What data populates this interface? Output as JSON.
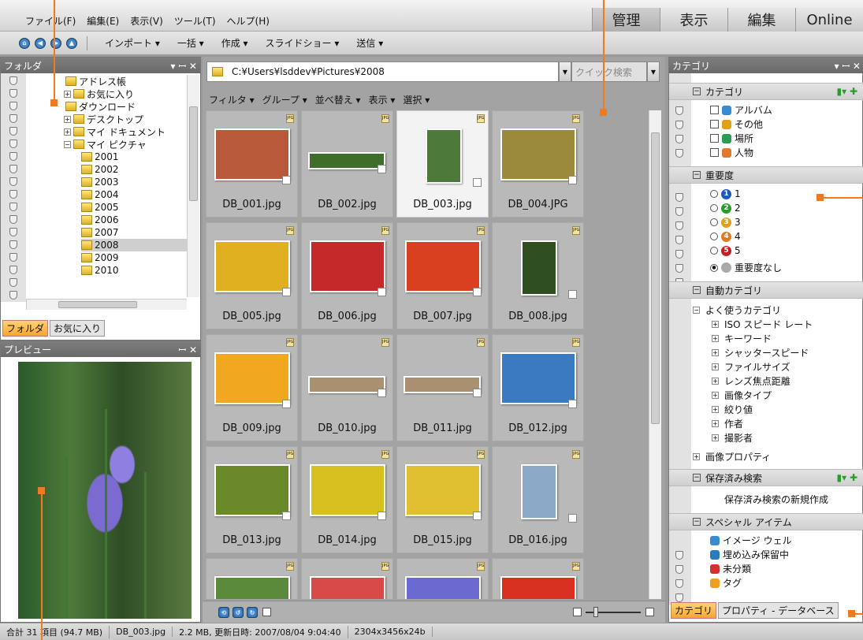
{
  "menu": [
    "ファイル(F)",
    "編集(E)",
    "表示(V)",
    "ツール(T)",
    "ヘルプ(H)"
  ],
  "modes": [
    "管理",
    "表示",
    "編集",
    "Online"
  ],
  "toolbar": {
    "items": [
      "インポート ▾",
      "一括 ▾",
      "作成 ▾",
      "スライドショー ▾",
      "送信 ▾"
    ]
  },
  "folder_pane": {
    "title": "フォルダ",
    "tree": [
      {
        "label": "アドレス帳",
        "level": 2
      },
      {
        "label": "お気に入り",
        "level": 1
      },
      {
        "label": "ダウンロード",
        "level": 2
      },
      {
        "label": "デスクトップ",
        "level": 1
      },
      {
        "label": "マイ ドキュメント",
        "level": 1
      },
      {
        "label": "マイ ピクチャ",
        "level": 1
      },
      {
        "label": "2001",
        "level": 3
      },
      {
        "label": "2002",
        "level": 3
      },
      {
        "label": "2003",
        "level": 3
      },
      {
        "label": "2004",
        "level": 3
      },
      {
        "label": "2005",
        "level": 3
      },
      {
        "label": "2006",
        "level": 3
      },
      {
        "label": "2007",
        "level": 3
      },
      {
        "label": "2008",
        "level": 3
      },
      {
        "label": "2009",
        "level": 3
      },
      {
        "label": "2010",
        "level": 3
      }
    ],
    "tabs": [
      "フォルダ",
      "お気に入り"
    ]
  },
  "preview_pane": {
    "title": "プレビュー"
  },
  "path": "C:¥Users¥lsddev¥Pictures¥2008",
  "quick_search_placeholder": "クイック検索",
  "filters": [
    "フィルタ ▾",
    "グループ ▾",
    "並べ替え ▾",
    "表示 ▾",
    "選択 ▾"
  ],
  "thumbnails": [
    {
      "name": "DB_001.jpg",
      "color": "#b85a3a"
    },
    {
      "name": "DB_002.jpg",
      "color": "#3f6d2a"
    },
    {
      "name": "DB_003.jpg",
      "color": "#4d7a3a",
      "selected": true
    },
    {
      "name": "DB_004.JPG",
      "color": "#9a8a3a"
    },
    {
      "name": "DB_005.jpg",
      "color": "#e0b020"
    },
    {
      "name": "DB_006.jpg",
      "color": "#c42a2a"
    },
    {
      "name": "DB_007.jpg",
      "color": "#d84020"
    },
    {
      "name": "DB_008.jpg",
      "color": "#2f4f20"
    },
    {
      "name": "DB_009.jpg",
      "color": "#f0a820"
    },
    {
      "name": "DB_010.jpg",
      "color": "#a89070"
    },
    {
      "name": "DB_011.jpg",
      "color": "#a89070"
    },
    {
      "name": "DB_012.jpg",
      "color": "#3a7ac0"
    },
    {
      "name": "DB_013.jpg",
      "color": "#6a8a2a"
    },
    {
      "name": "DB_014.jpg",
      "color": "#d8c020"
    },
    {
      "name": "DB_015.jpg",
      "color": "#e0c030"
    },
    {
      "name": "DB_016.jpg",
      "color": "#8aaac8"
    },
    {
      "name": "",
      "color": "#5a8a3a"
    },
    {
      "name": "",
      "color": "#d84a4a"
    },
    {
      "name": "",
      "color": "#6a6ad0"
    },
    {
      "name": "",
      "color": "#d83020"
    }
  ],
  "category_pane": {
    "title": "カテゴリ",
    "sections": {
      "categories": "カテゴリ",
      "category_items": [
        "アルバム",
        "その他",
        "場所",
        "人物"
      ],
      "importance": "重要度",
      "importance_items": [
        "1",
        "2",
        "3",
        "4",
        "5"
      ],
      "importance_none": "重要度なし",
      "auto": "自動カテゴリ",
      "auto_root": "よく使うカテゴリ",
      "auto_items": [
        "ISO スピード レート",
        "キーワード",
        "シャッタースピード",
        "ファイルサイズ",
        "レンズ焦点距離",
        "画像タイプ",
        "絞り値",
        "作者",
        "撮影者"
      ],
      "image_props": "画像プロパティ",
      "saved": "保存済み検索",
      "saved_new": "保存済み検索の新規作成",
      "special": "スペシャル アイテム",
      "special_items": [
        "イメージ ウェル",
        "埋め込み保留中",
        "未分類",
        "タグ"
      ]
    },
    "tabs": [
      "カテゴリ",
      "プロパティ - データベース"
    ]
  },
  "status": [
    "合計 31 項目 (94.7 MB)",
    "DB_003.jpg",
    "2.2 MB, 更新日時: 2007/08/04 9:04:40",
    "2304x3456x24b"
  ]
}
